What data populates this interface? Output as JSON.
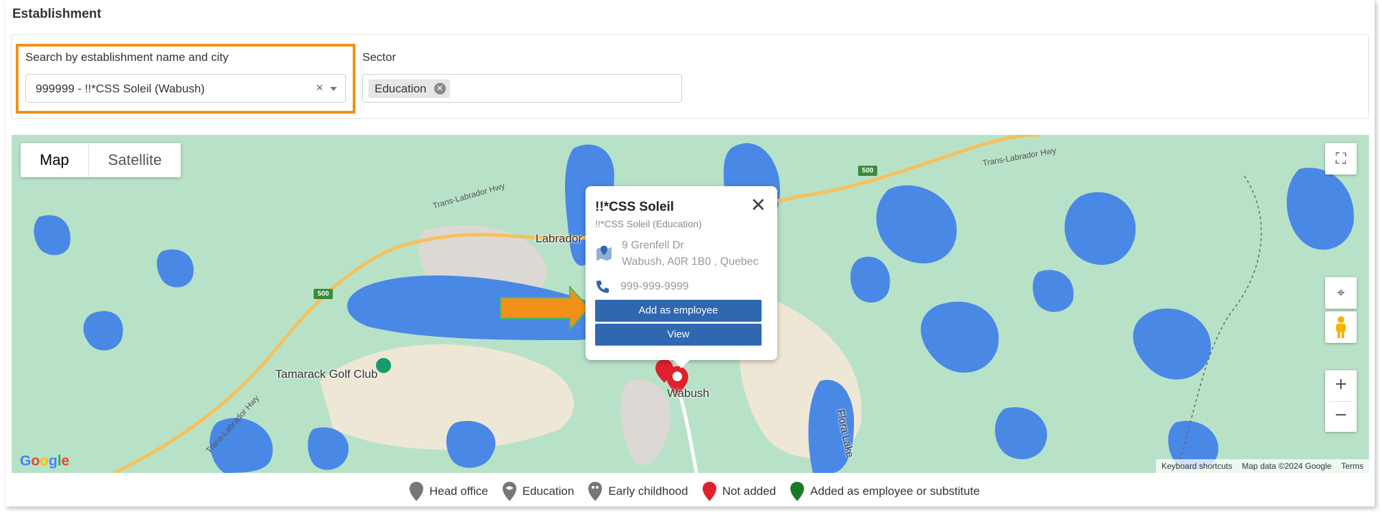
{
  "section": {
    "title": "Establishment"
  },
  "filters": {
    "establishment_label": "Search by establishment name and city",
    "establishment_value": "999999 - !!*CSS Soleil (Wabush)",
    "clear_symbol": "×",
    "sector_label": "Sector",
    "sector_chip": "Education"
  },
  "map": {
    "type_map": "Map",
    "type_satellite": "Satellite",
    "labels": {
      "labrador": "Labrador",
      "tamarack": "Tamarack Golf Club",
      "wabush": "Wabush",
      "flora_lake": "Flora Lake",
      "hwy_1": "Trans-Labrador Hwy",
      "hwy_2": "Trans-Labrador Hwy",
      "hwy_3": "Trans-Labrador Hwy",
      "shield_1": "500",
      "shield_2": "500"
    },
    "google_logo": "Google",
    "attribution": {
      "shortcuts": "Keyboard shortcuts",
      "data": "Map data ©2024 Google",
      "terms": "Terms"
    },
    "colors": {
      "land": "#b8e2c7",
      "water": "#4a88e6",
      "sand": "#efe7d6",
      "road": "#f5c15c",
      "marker_red": "#e0202e",
      "marker_green": "#1a7a2a",
      "button_blue": "#2f67b0",
      "highlight_orange": "#f39019"
    }
  },
  "infowindow": {
    "title": "!!*CSS Soleil",
    "subtitle": "!!*CSS Soleil (Education)",
    "address_line1": "9 Grenfell Dr",
    "address_line2": "Wabush, A0R 1B0 , Quebec",
    "phone": "999-999-9999",
    "close_symbol": "✕",
    "add_employee_label": "Add as employee",
    "view_label": "View"
  },
  "legend": {
    "head_office": "Head office",
    "education": "Education",
    "early_childhood": "Early childhood",
    "not_added": "Not added",
    "added": "Added as employee or substitute"
  }
}
